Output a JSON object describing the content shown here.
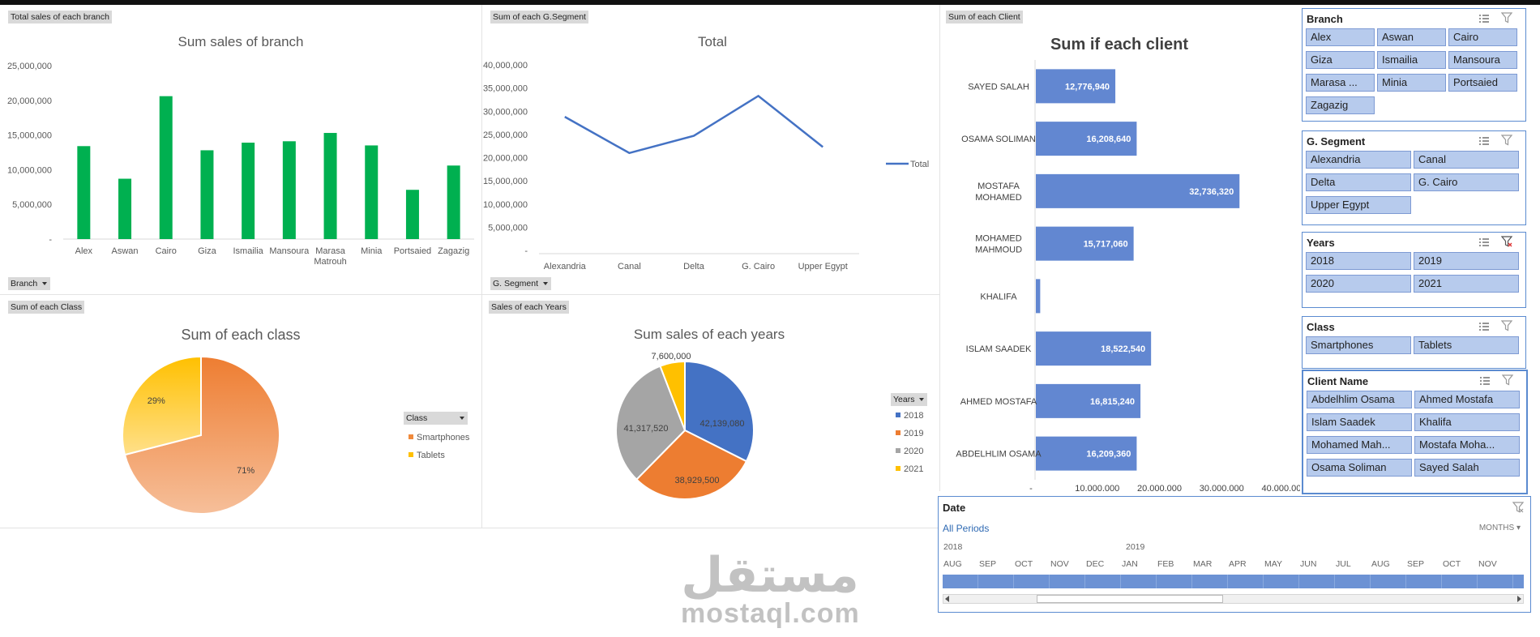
{
  "tags": {
    "branch_panel": "Total sales of each branch",
    "segment_panel": "Sum of each G.Segment",
    "client_panel": "Sum of each Client",
    "class_panel": "Sum of each Class",
    "years_panel": "Sales of each Years"
  },
  "field_buttons": {
    "branch": "Branch",
    "segment": "G. Segment",
    "class": "Class",
    "years": "Years"
  },
  "chart_data": [
    {
      "type": "bar",
      "title": "Sum sales of branch",
      "categories": [
        "Alex",
        "Aswan",
        "Cairo",
        "Giza",
        "Ismailia",
        "Mansoura",
        "Marasa Matrouh",
        "Minia",
        "Portsaied",
        "Zagazig"
      ],
      "values": [
        13400000,
        8700000,
        20600000,
        12800000,
        13900000,
        14100000,
        15300000,
        13500000,
        7100000,
        10600000
      ],
      "ylim": [
        0,
        25000000
      ],
      "yticks": [
        "-",
        "5,000,000",
        "10,000,000",
        "15,000,000",
        "20,000,000",
        "25,000,000"
      ],
      "color": "#00b050",
      "legend": "none"
    },
    {
      "type": "line",
      "title": "Total",
      "categories": [
        "Alexandria",
        "Canal",
        "Delta",
        "G. Cairo",
        "Upper Egypt"
      ],
      "series": [
        {
          "name": "Total",
          "values": [
            28800000,
            21000000,
            24700000,
            33300000,
            22300000
          ]
        }
      ],
      "ylim": [
        0,
        40000000
      ],
      "yticks": [
        "-",
        "5,000,000",
        "10,000,000",
        "15,000,000",
        "20,000,000",
        "25,000,000",
        "30,000,000",
        "35,000,000",
        "40,000,000"
      ],
      "color": "#4472c4",
      "legend": "right"
    },
    {
      "type": "bar",
      "orientation": "horizontal",
      "title": "Sum if each client",
      "categories": [
        "SAYED SALAH",
        "OSAMA SOLIMAN",
        "MOSTAFA MOHAMED",
        "MOHAMED MAHMOUD",
        "KHALIFA",
        "ISLAM SAADEK",
        "AHMED MOSTAFA",
        "ABDELHLIM OSAMA"
      ],
      "values": [
        12776940,
        16208640,
        32736320,
        15717060,
        700000,
        18522540,
        16815240,
        16209360
      ],
      "data_labels": [
        "12,776,940",
        "16,208,640",
        "32,736,320",
        "15,717,060",
        "",
        "18,522,540",
        "16,815,240",
        "16,209,360"
      ],
      "xlim": [
        0,
        40000000
      ],
      "xticks": [
        "-",
        "10,000,000",
        "20,000,000",
        "30,000,000",
        "40,000,000"
      ],
      "color": "#6287d1"
    },
    {
      "type": "pie",
      "title": "Sum of each class",
      "labels": [
        "Smartphones",
        "Tablets"
      ],
      "values": [
        71,
        29
      ],
      "data_labels": [
        "71%",
        "29%"
      ],
      "colors": [
        "#f08a3c",
        "#ffc000"
      ],
      "legend_title": "Class",
      "legend": "right"
    },
    {
      "type": "pie",
      "title": "Sum sales of each years",
      "labels": [
        "2018",
        "2019",
        "2020",
        "2021"
      ],
      "values": [
        42139080,
        38929500,
        41317520,
        7600000
      ],
      "data_labels": [
        "42,139,080",
        "38,929,500",
        "41,317,520",
        "7,600,000"
      ],
      "colors": [
        "#4472c4",
        "#ed7d31",
        "#a5a5a5",
        "#ffc000"
      ],
      "legend_title": "Years",
      "legend": "right"
    }
  ],
  "slicers": {
    "branch": {
      "title": "Branch",
      "items": [
        "Alex",
        "Aswan",
        "Cairo",
        "Giza",
        "Ismailia",
        "Mansoura",
        "Marasa ...",
        "Minia",
        "Portsaied",
        "Zagazig"
      ]
    },
    "segment": {
      "title": "G. Segment",
      "items": [
        "Alexandria",
        "Canal",
        "Delta",
        "G. Cairo",
        "Upper Egypt"
      ]
    },
    "years": {
      "title": "Years",
      "items": [
        "2018",
        "2019",
        "2020",
        "2021"
      ]
    },
    "class": {
      "title": "Class",
      "items": [
        "Smartphones",
        "Tablets"
      ]
    },
    "client": {
      "title": "Client Name",
      "items": [
        "Abdelhlim Osama",
        "Ahmed Mostafa",
        "Islam Saadek",
        "Khalifa",
        "Mohamed Mah...",
        "Mostafa Moha...",
        "Osama Soliman",
        "Sayed Salah"
      ]
    }
  },
  "timeline": {
    "title": "Date",
    "period": "All Periods",
    "level": "MONTHS",
    "years": [
      "2018",
      "2019"
    ],
    "months": [
      "AUG",
      "SEP",
      "OCT",
      "NOV",
      "DEC",
      "JAN",
      "FEB",
      "MAR",
      "APR",
      "MAY",
      "JUN",
      "JUL",
      "AUG",
      "SEP",
      "OCT",
      "NOV"
    ]
  },
  "watermark": {
    "arabic": "مستقل",
    "latin": "mostaql.com"
  },
  "icons": {
    "multiselect": "multi-select-icon",
    "clear": "clear-filter-icon"
  }
}
